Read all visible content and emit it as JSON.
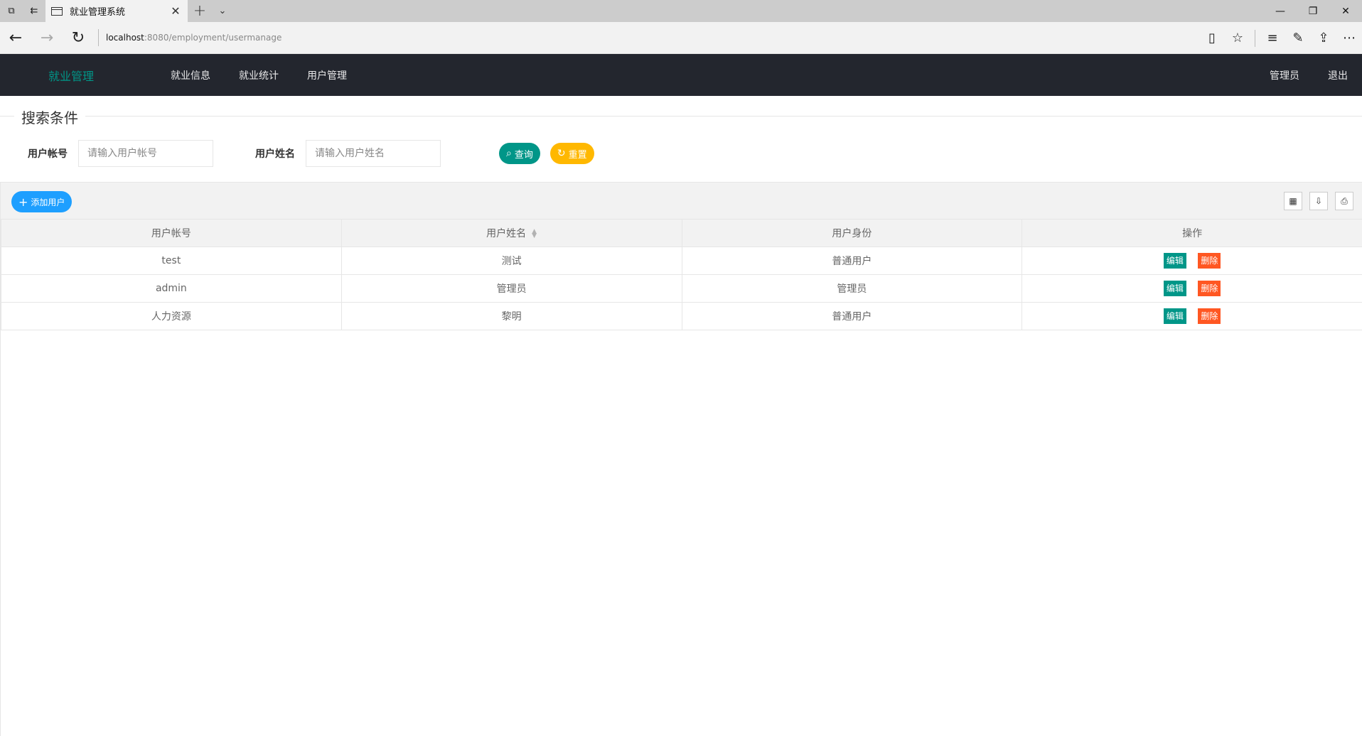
{
  "browser": {
    "tab_title": "就业管理系统",
    "url_host": "localhost",
    "url_rest": ":8080/employment/usermanage"
  },
  "header": {
    "logo": "就业管理",
    "nav": [
      "就业信息",
      "就业统计",
      "用户管理"
    ],
    "user": "管理员",
    "logout": "退出"
  },
  "search": {
    "legend": "搜索条件",
    "account_label": "用户帐号",
    "account_placeholder": "请输入用户帐号",
    "name_label": "用户姓名",
    "name_placeholder": "请输入用户姓名",
    "query_label": "查询",
    "reset_label": "重置"
  },
  "toolbar": {
    "add_label": "添加用户"
  },
  "table": {
    "columns": [
      "用户帐号",
      "用户姓名",
      "用户身份",
      "操作"
    ],
    "rows": [
      {
        "account": "test",
        "name": "测试",
        "role": "普通用户"
      },
      {
        "account": "admin",
        "name": "管理员",
        "role": "管理员"
      },
      {
        "account": "人力资源",
        "name": "黎明",
        "role": "普通用户"
      }
    ],
    "edit_label": "编辑",
    "delete_label": "删除"
  },
  "colors": {
    "accent": "#009688",
    "header_bg": "#23262e",
    "add_button": "#1e9fff",
    "reset_button": "#ffb800",
    "delete_button": "#ff5722"
  }
}
